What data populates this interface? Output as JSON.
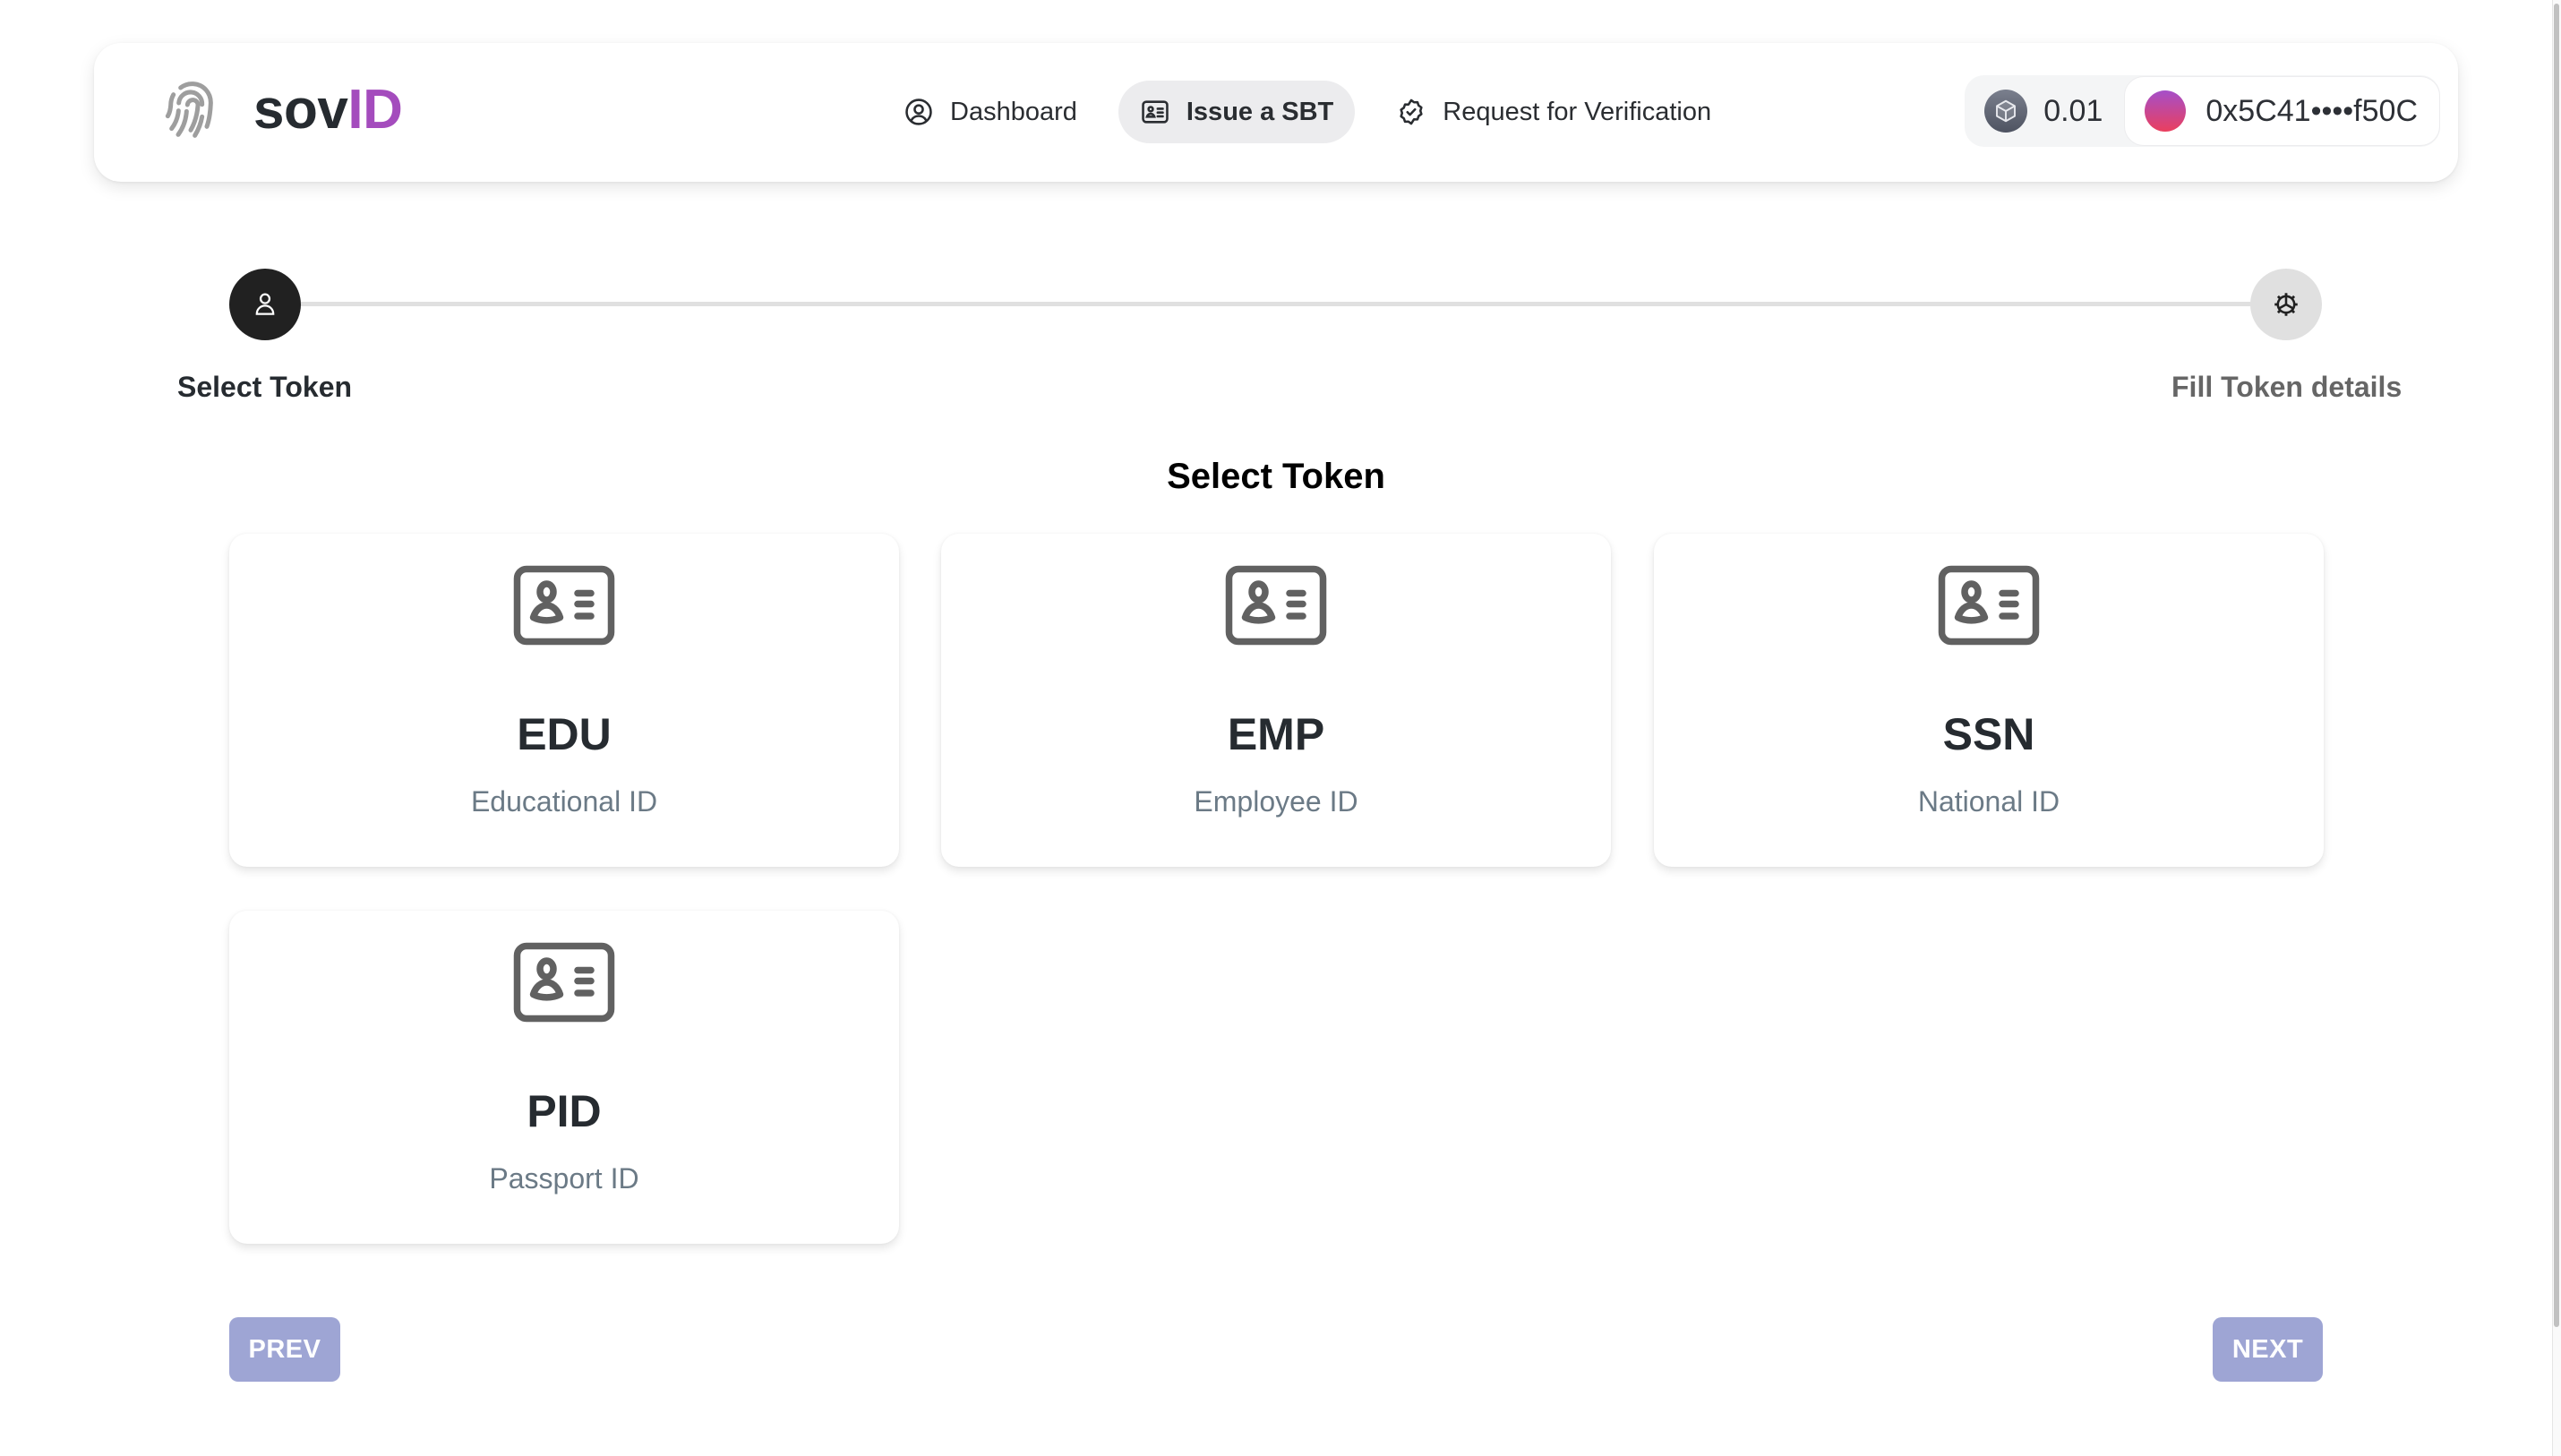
{
  "brand": {
    "name_part1": "sov",
    "name_part2": "ID",
    "accent_color": "#a44cbd"
  },
  "nav": {
    "items": [
      {
        "label": "Dashboard",
        "icon": "user-circle-icon",
        "active": false
      },
      {
        "label": "Issue a SBT",
        "icon": "id-card-icon",
        "active": true
      },
      {
        "label": "Request for Verification",
        "icon": "badge-check-icon",
        "active": false
      }
    ]
  },
  "wallet": {
    "balance": "0.01",
    "chain_icon": "cube-icon",
    "address": "0x5C41••••f50C"
  },
  "stepper": {
    "steps": [
      {
        "label": "Select Token",
        "icon": "user-icon",
        "active": true
      },
      {
        "label": "Fill Token details",
        "icon": "gear-icon",
        "active": false
      }
    ]
  },
  "main": {
    "title": "Select Token",
    "tokens": [
      {
        "code": "EDU",
        "description": "Educational ID",
        "icon": "id-card-icon"
      },
      {
        "code": "EMP",
        "description": "Employee ID",
        "icon": "id-card-icon"
      },
      {
        "code": "SSN",
        "description": "National ID",
        "icon": "id-card-icon"
      },
      {
        "code": "PID",
        "description": "Passport ID",
        "icon": "id-card-icon"
      }
    ]
  },
  "buttons": {
    "prev": "PREV",
    "next": "NEXT",
    "color": "#9ea5d4"
  }
}
